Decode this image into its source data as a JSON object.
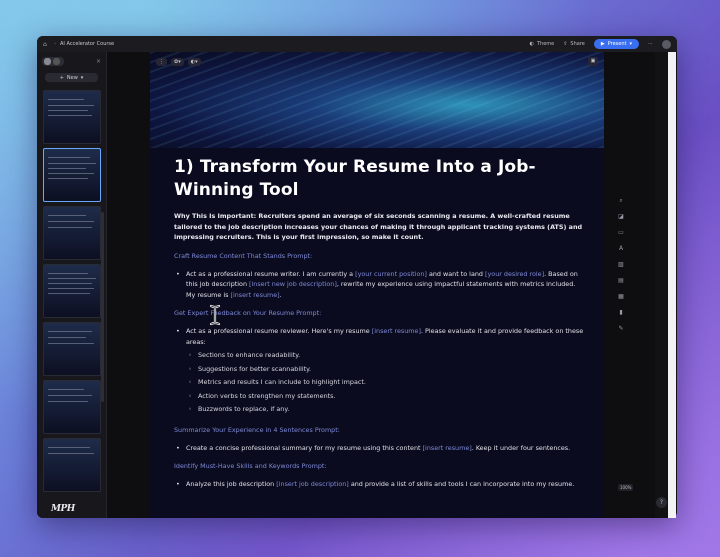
{
  "app": {
    "breadcrumb_title": "AI Accelerator Course",
    "buttons": {
      "theme": "Theme",
      "share": "Share",
      "present": "Present"
    }
  },
  "sidebar": {
    "new_label": "New",
    "logo_text": "MPH"
  },
  "slide_toolbar": {
    "chip1": "✿▾",
    "chip2": "◐▾"
  },
  "slide": {
    "title": "1) Transform Your Resume Into a Job-Winning Tool",
    "intro": "Why This Is Important: Recruiters spend an average of six seconds scanning a resume. A well-crafted resume tailored to the job description increases your chances of making it through applicant tracking systems (ATS) and impressing recruiters. This is your first impression, so make it count.",
    "sections": [
      {
        "heading": "Craft Resume Content That Stands Prompt:",
        "bullet_parts": [
          "Act as a professional resume writer. I am currently a ",
          "[your current position]",
          " and want to land ",
          "[your desired role]",
          ". Based on this job description ",
          "[insert new job description]",
          ", rewrite my experience using impactful statements with metrics included. My resume is ",
          "[insert resume]",
          "."
        ]
      },
      {
        "heading": "Get Expert Feedback on Your Resume Prompt:",
        "bullet_parts": [
          "Act as a professional resume reviewer. Here's my resume ",
          "[insert resume]",
          ". Please evaluate it and provide feedback on these areas:"
        ],
        "subitems": [
          "Sections to enhance readability.",
          "Suggestions for better scannability.",
          "Metrics and results I can include to highlight impact.",
          "Action verbs to strengthen my statements.",
          "Buzzwords to replace, if any."
        ]
      },
      {
        "heading": "Summarize Your Experience in 4 Sentences Prompt:",
        "bullet_parts": [
          "Create a concise professional summary for my resume using this content ",
          "[insert resume]",
          ". Keep it under four sentences."
        ]
      },
      {
        "heading": "Identify Must-Have Skills and Keywords Prompt:",
        "bullet_parts": [
          "Analyze this job description ",
          "[insert job description]",
          " and provide a list of skills and tools I can incorporate into my resume."
        ]
      }
    ]
  },
  "status": {
    "zoom": "100%",
    "help": "?"
  },
  "colors": {
    "accent": "#3a6ef0",
    "placeholder": "#7f8ad8",
    "slide_bg": "#0a0b1e"
  }
}
